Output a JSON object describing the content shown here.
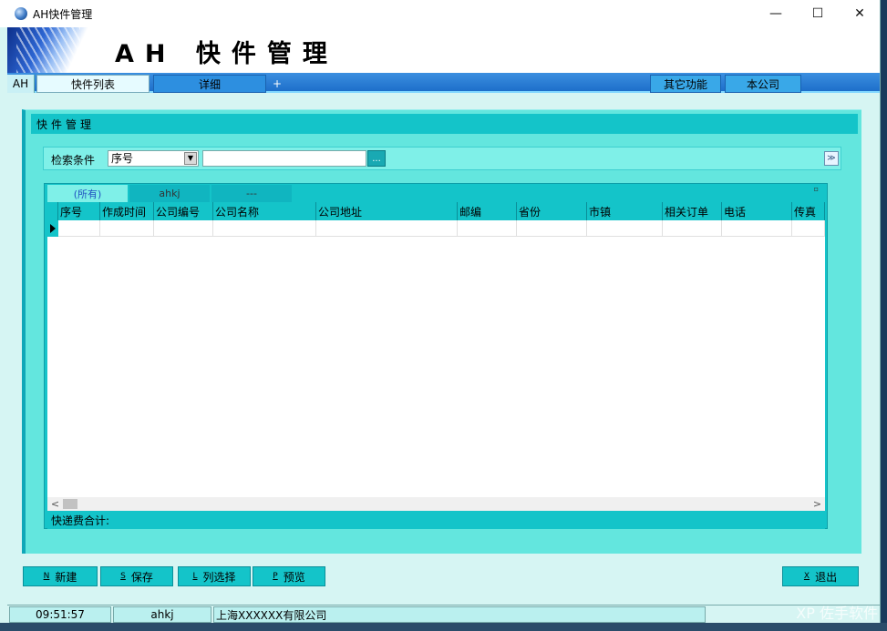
{
  "window": {
    "title": "AH快件管理",
    "minimize": "—",
    "maximize": "☐",
    "close": "✕"
  },
  "banner": {
    "title": "AH 快件管理"
  },
  "tabs": {
    "ah": "AH",
    "list": "快件列表",
    "detail": "详细",
    "plus": "+",
    "other": "其它功能",
    "company": "本公司"
  },
  "panel": {
    "title": "快件管理"
  },
  "search": {
    "label": "检索条件",
    "field": "序号",
    "value": "",
    "button": "...",
    "collapse": "≫"
  },
  "grid": {
    "tabs": [
      "(所有)",
      "ahkj",
      "---"
    ],
    "columns": [
      {
        "label": "序号"
      },
      {
        "label": "作成时间"
      },
      {
        "label": "公司编号"
      },
      {
        "label": "公司名称"
      },
      {
        "label": "公司地址"
      },
      {
        "label": "邮编"
      },
      {
        "label": "省份"
      },
      {
        "label": "市镇"
      },
      {
        "label": "相关订单"
      },
      {
        "label": "电话"
      },
      {
        "label": "传真"
      }
    ],
    "total_label": "快递费合计:",
    "scroll_left": "<",
    "scroll_right": ">"
  },
  "buttons": {
    "new": {
      "key": "N",
      "label": "新建"
    },
    "save": {
      "key": "S",
      "label": "保存"
    },
    "columns": {
      "key": "L",
      "label": "列选择"
    },
    "preview": {
      "key": "P",
      "label": "预览"
    },
    "exit": {
      "key": "X",
      "label": "退出"
    }
  },
  "status": {
    "time": "09:51:57",
    "user": "ahkj",
    "company": "上海XXXXXX有限公司"
  },
  "watermark": "XP 佐手软件"
}
